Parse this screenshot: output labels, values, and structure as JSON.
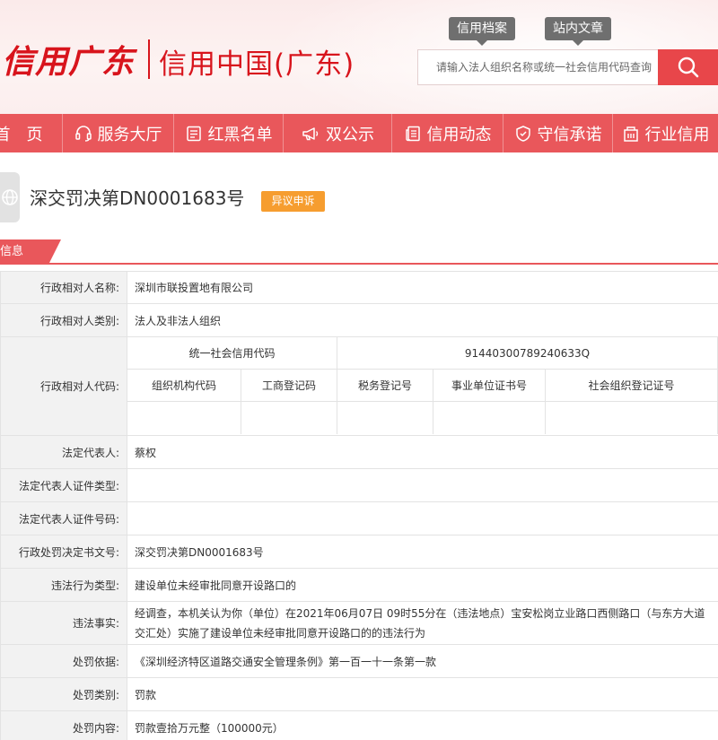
{
  "header": {
    "logo_script": "信用广东",
    "logo_text": "信用中国(广东)",
    "tabs": [
      "信用档案",
      "站内文章"
    ],
    "search_placeholder": "请输入法人组织名称或统一社会信用代码查询"
  },
  "nav": {
    "items": [
      {
        "label": "首　页",
        "icon": "home-icon"
      },
      {
        "label": "服务大厅",
        "icon": "headset-icon"
      },
      {
        "label": "红黑名单",
        "icon": "list-icon"
      },
      {
        "label": "双公示",
        "icon": "megaphone-icon"
      },
      {
        "label": "信用动态",
        "icon": "news-icon"
      },
      {
        "label": "守信承诺",
        "icon": "shield-icon"
      },
      {
        "label": "行业信用",
        "icon": "building-icon"
      }
    ]
  },
  "page": {
    "title": "深交罚决第DN0001683号",
    "appeal_label": "异议申诉",
    "section_label": "基础信息"
  },
  "record": {
    "rows": [
      {
        "label": "行政相对人名称:",
        "value": "深圳市联投置地有限公司"
      },
      {
        "label": "行政相对人类别:",
        "value": "法人及非法人组织"
      },
      {
        "label": "法定代表人:",
        "value": "蔡权"
      },
      {
        "label": "法定代表人证件类型:",
        "value": ""
      },
      {
        "label": "法定代表人证件号码:",
        "value": ""
      },
      {
        "label": "行政处罚决定书文号:",
        "value": "深交罚决第DN0001683号"
      },
      {
        "label": "违法行为类型:",
        "value": "建设单位未经审批同意开设路口的"
      },
      {
        "label": "违法事实:",
        "value": "经调查，本机关认为你（单位）在2021年06月07日 09时55分在（违法地点）宝安松岗立业路口西侧路口（与东方大道交汇处）实施了建设单位未经审批同意开设路口的的违法行为"
      },
      {
        "label": "处罚依据:",
        "value": "《深圳经济特区道路交通安全管理条例》第一百一十一条第一款"
      },
      {
        "label": "处罚类别:",
        "value": "罚款"
      },
      {
        "label": "处罚内容:",
        "value": "罚款壹拾万元整（100000元）"
      }
    ],
    "codes": {
      "label": "行政相对人代码:",
      "usc_header": "统一社会信用代码",
      "usc_value": "91440300789240633Q",
      "sub_headers": [
        "组织机构代码",
        "工商登记码",
        "税务登记号",
        "事业单位证书号",
        "社会组织登记证号"
      ],
      "sub_values": [
        "",
        "",
        "",
        "",
        ""
      ]
    }
  },
  "colors": {
    "brand_red": "#d8141c",
    "nav_red": "#e9575b",
    "appeal_orange": "#f69d2f"
  }
}
